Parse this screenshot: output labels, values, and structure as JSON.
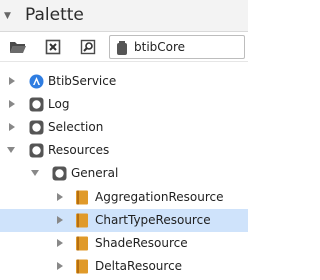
{
  "header": {
    "title": "Palette",
    "collapse_icon": "triangle-down-icon"
  },
  "toolbar": {
    "buttons": [
      {
        "name": "open-folder-button",
        "icon": "folder-open-icon"
      },
      {
        "name": "close-palette-button",
        "icon": "close-box-icon"
      },
      {
        "name": "search-button",
        "icon": "search-icon"
      }
    ],
    "module": {
      "icon": "jar-icon",
      "value": "btibCore"
    }
  },
  "colors": {
    "accent_blue": "#2f7de1",
    "folder_gray": "#555555",
    "resource_orange": "#e09a2a",
    "selection_bg": "#cfe3fb"
  },
  "tree": {
    "items": [
      {
        "label": "BtibService",
        "icon": "service-icon",
        "toggle": "collapsed",
        "selected": false
      },
      {
        "label": "Log",
        "icon": "folder-icon",
        "toggle": "collapsed",
        "selected": false
      },
      {
        "label": "Selection",
        "icon": "folder-icon",
        "toggle": "collapsed",
        "selected": false
      },
      {
        "label": "Resources",
        "icon": "folder-icon",
        "toggle": "expanded",
        "selected": false
      },
      {
        "label": "General",
        "icon": "folder-icon",
        "toggle": "expanded",
        "selected": false
      },
      {
        "label": "AggregationResource",
        "icon": "resource-icon",
        "toggle": "collapsed",
        "selected": false
      },
      {
        "label": "ChartTypeResource",
        "icon": "resource-icon",
        "toggle": "collapsed",
        "selected": true
      },
      {
        "label": "ShadeResource",
        "icon": "resource-icon",
        "toggle": "collapsed",
        "selected": false
      },
      {
        "label": "DeltaResource",
        "icon": "resource-icon",
        "toggle": "collapsed",
        "selected": false
      }
    ]
  }
}
